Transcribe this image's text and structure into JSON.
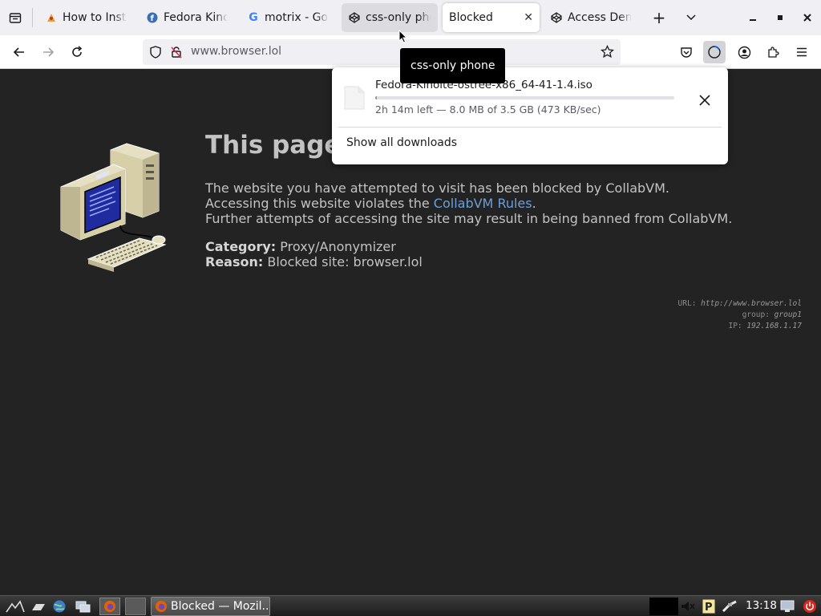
{
  "tabs": [
    {
      "label": "How to Insta",
      "icon": "colorful-favicon-icon"
    },
    {
      "label": "Fedora Kino",
      "icon": "fedora-icon"
    },
    {
      "label": "motrix - Goo",
      "icon": "google-icon"
    },
    {
      "label": "css-only pho",
      "icon": "codepen-icon"
    },
    {
      "label": "Blocked",
      "icon": ""
    },
    {
      "label": "Access Deni",
      "icon": "codepen-icon"
    }
  ],
  "navbar": {
    "url": "www.browser.lol"
  },
  "tooltip": "css-only phone",
  "downloads": {
    "filename": "Fedora-Kinoite-ostree-x86_64-41-1.4.iso",
    "status": "2h 14m left — 8.0 MB of 3.5 GB (473 KB/sec)",
    "progress_fraction": 0.005,
    "show_all": "Show all downloads"
  },
  "page": {
    "heading": "This page",
    "line1": "The website you have attempted to visit has been blocked by CollabVM.",
    "line2_prefix": "Accessing this website violates the ",
    "line2_link": "CollabVM Rules",
    "line2_suffix": ".",
    "line3": "Further attempts of accessing the site may result in being banned from CollabVM.",
    "category_label": "Category:",
    "category_value": "Proxy/Anonymizer",
    "reason_label": "Reason:",
    "reason_value": "Blocked site: browser.lol",
    "meta_url_label": "URL: ",
    "meta_url_value": "http://www.browser.lol",
    "meta_group_label": "group: ",
    "meta_group_value": "group1",
    "meta_ip_label": "IP: ",
    "meta_ip_value": "192.168.1.17"
  },
  "taskbar": {
    "window_title": "Blocked — Mozil...",
    "clock": "13:18"
  },
  "colors": {
    "link": "#6c9fd9",
    "page_bg": "#232323",
    "tooltip_bg": "#000000"
  }
}
